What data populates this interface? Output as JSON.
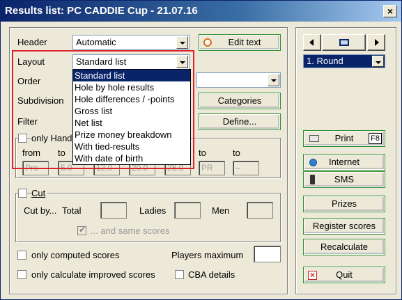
{
  "window": {
    "title": "Results list: PC CADDIE Cup - 21.07.16",
    "close_glyph": "×"
  },
  "form": {
    "header_label": "Header",
    "header_value": "Automatic",
    "edit_text_label": "Edit text",
    "layout_label": "Layout",
    "layout_value": "Standard list",
    "order_label": "Order",
    "subdivision_label": "Subdivision",
    "categories_label": "Categories",
    "filter_label": "Filter",
    "define_label": "Define...",
    "only_handicap_label": "only Hand",
    "from_label": "from",
    "to_label": "to",
    "to2_label": "to",
    "to3_label": "to",
    "field_values": [
      "Pro",
      "5.0",
      "12.0",
      "20.0",
      "28.0",
      "PR",
      "–"
    ],
    "cut_label": "Cut",
    "cut_by_label": "Cut by...",
    "total_label": "Total",
    "ladies_label": "Ladies",
    "men_label": "Men",
    "same_scores_label": "... and same scores",
    "only_computed_label": "only computed scores",
    "players_max_label": "Players maximum",
    "only_improved_label": "only calculate improved scores",
    "cba_label": "CBA details"
  },
  "layout_dropdown": {
    "options": [
      "Standard list",
      "Hole by hole results",
      "Hole differences / -points",
      "Gross list",
      "Net list",
      "Prize money breakdown",
      "With tied-results",
      "With date of birth"
    ],
    "selected_index": 0
  },
  "right_panel": {
    "round_value": "1. Round",
    "print_label": "Print",
    "print_key": "F8",
    "internet_label": "Internet",
    "sms_label": "SMS",
    "prizes_label": "Prizes",
    "register_label": "Register scores",
    "recalculate_label": "Recalculate",
    "quit_label": "Quit"
  },
  "colors": {
    "highlight_box": "#e0202a",
    "selection": "#0a246a",
    "title_gradient_start": "#0a246a"
  }
}
